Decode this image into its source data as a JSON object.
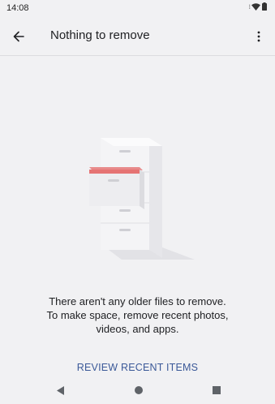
{
  "status_bar": {
    "time": "14:08",
    "icons": [
      "signal-dots-icon",
      "wifi-icon",
      "battery-icon"
    ]
  },
  "app_bar": {
    "title": "Nothing to remove",
    "back_icon": "arrow-back-icon",
    "menu_icon": "more-vert-icon"
  },
  "message": {
    "line1": "There aren't any older files to remove.",
    "line2": "To make space, remove recent photos,",
    "line3": "videos, and apps."
  },
  "actions": {
    "review_label": "REVIEW RECENT ITEMS"
  },
  "nav_bar": {
    "icons": [
      "nav-back-icon",
      "nav-home-icon",
      "nav-recents-icon"
    ]
  },
  "colors": {
    "background": "#f1f1f3",
    "accent": "#3b5998",
    "drawer_highlight": "#e57373"
  }
}
